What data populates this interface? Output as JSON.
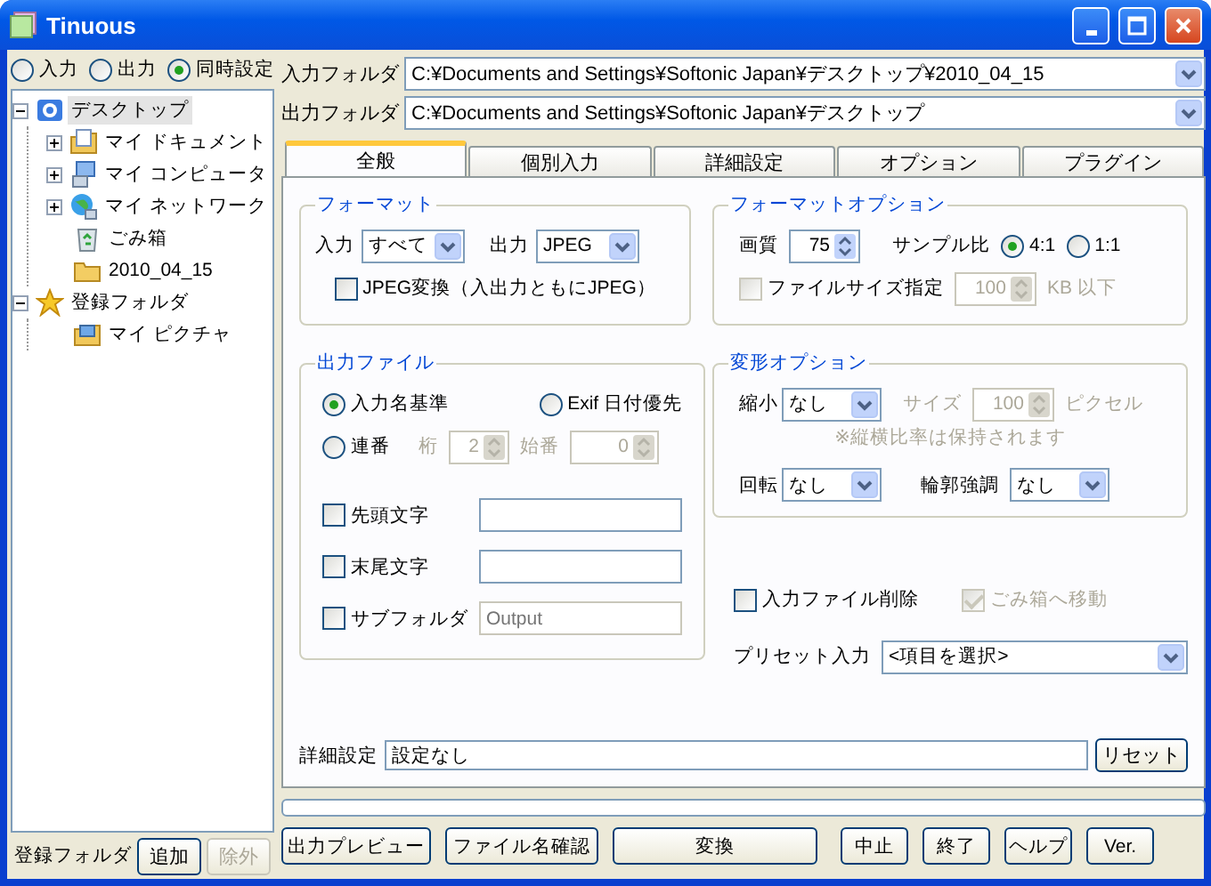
{
  "window": {
    "title": "Tinuous"
  },
  "mode": [
    {
      "label": "入力",
      "selected": false
    },
    {
      "label": "出力",
      "selected": false
    },
    {
      "label": "同時設定",
      "selected": true
    }
  ],
  "tree": [
    {
      "label": "デスクトップ",
      "kind": "desktop",
      "expanded": true,
      "selected": true,
      "children": [
        {
          "label": "マイ ドキュメント",
          "kind": "documents",
          "expanded": false,
          "selected": false
        },
        {
          "label": "マイ コンピュータ",
          "kind": "computer",
          "expanded": false,
          "selected": false
        },
        {
          "label": "マイ ネットワーク",
          "kind": "network",
          "expanded": false,
          "selected": false
        },
        {
          "label": "ごみ箱",
          "kind": "trash",
          "selected": false
        },
        {
          "label": "2010_04_15",
          "kind": "folder",
          "selected": false
        }
      ]
    },
    {
      "label": "登録フォルダ",
      "kind": "favorites",
      "expanded": true,
      "selected": false,
      "children": [
        {
          "label": "マイ ピクチャ",
          "kind": "pictures",
          "selected": false
        }
      ]
    }
  ],
  "registered": {
    "label": "登録フォルダ",
    "buttons": [
      {
        "label": "追加",
        "disabled": false
      },
      {
        "label": "除外",
        "disabled": true
      }
    ]
  },
  "folders": [
    {
      "label": "入力フォルダ",
      "value": "C:¥Documents and Settings¥Softonic Japan¥デスクトップ¥2010_04_15"
    },
    {
      "label": "出力フォルダ",
      "value": "C:¥Documents and Settings¥Softonic Japan¥デスクトップ"
    }
  ],
  "tabs": [
    {
      "label": "全般",
      "selected": true
    },
    {
      "label": "個別入力",
      "selected": false
    },
    {
      "label": "詳細設定",
      "selected": false
    },
    {
      "label": "オプション",
      "selected": false
    },
    {
      "label": "プラグイン",
      "selected": false
    }
  ],
  "format": {
    "title": "フォーマット",
    "input": {
      "label": "入力",
      "value": "すべて"
    },
    "output": {
      "label": "出力",
      "value": "JPEG"
    },
    "jpeg_convert": {
      "label": "JPEG変換（入出力ともにJPEG）",
      "checked": false
    }
  },
  "format_options": {
    "title": "フォーマットオプション",
    "quality": {
      "label": "画質",
      "value": "75"
    },
    "sample_ratio": {
      "label": "サンプル比",
      "options": [
        {
          "label": "4:1",
          "selected": true
        },
        {
          "label": "1:1",
          "selected": false
        }
      ]
    },
    "file_size": {
      "label": "ファイルサイズ指定",
      "checked": false,
      "value": "100",
      "unit": "KB 以下",
      "disabled": true
    }
  },
  "output_file": {
    "title": "出力ファイル",
    "naming": [
      {
        "label": "入力名基準",
        "selected": true
      },
      {
        "label": "Exif 日付優先",
        "selected": false
      },
      {
        "label": "連番",
        "selected": false
      }
    ],
    "digits": {
      "label": "桁",
      "value": "2",
      "disabled": true
    },
    "start": {
      "label": "始番",
      "value": "0",
      "disabled": true
    },
    "text_options": [
      {
        "label": "先頭文字",
        "checked": false
      },
      {
        "label": "末尾文字",
        "checked": false
      },
      {
        "label": "サブフォルダ",
        "checked": false,
        "placeholder": "Output"
      }
    ]
  },
  "transform": {
    "title": "変形オプション",
    "shrink": {
      "label": "縮小",
      "value": "なし"
    },
    "size": {
      "label": "サイズ",
      "value": "100",
      "unit": "ピクセル",
      "disabled": true
    },
    "note": {
      "text": "※縦横比率は保持されます",
      "disabled": true
    },
    "rotate": {
      "label": "回転",
      "value": "なし"
    },
    "sharpen": {
      "label": "輪郭強調",
      "value": "なし"
    }
  },
  "delete_input": {
    "label": "入力ファイル削除",
    "checked": false,
    "disabled": false
  },
  "move_to_trash": {
    "label": "ごみ箱へ移動",
    "checked": true,
    "disabled": true
  },
  "preset": {
    "label": "プリセット入力",
    "value": "<項目を選択>"
  },
  "details": {
    "label": "詳細設定",
    "value": "設定なし",
    "button": "リセット"
  },
  "progress": {
    "level": 0
  },
  "buttons": [
    "出力プレビュー",
    "ファイル名確認",
    "変換",
    "中止",
    "終了",
    "ヘルプ",
    "Ver."
  ]
}
